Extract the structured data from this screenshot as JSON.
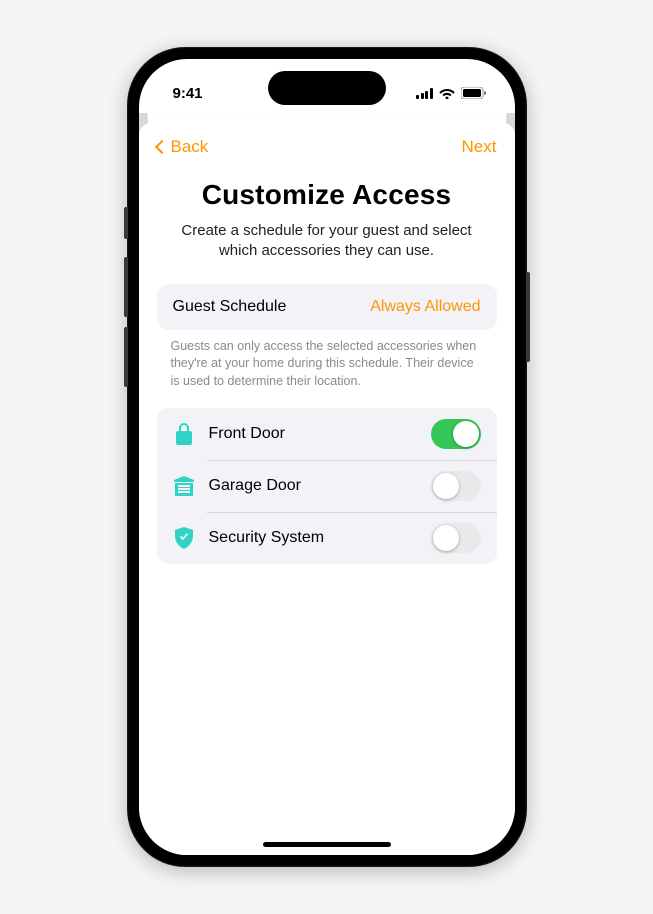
{
  "statusbar": {
    "time": "9:41"
  },
  "nav": {
    "back_label": "Back",
    "next_label": "Next"
  },
  "header": {
    "title": "Customize Access",
    "subtitle": "Create a schedule for your guest and select which accessories they can use."
  },
  "schedule": {
    "label": "Guest Schedule",
    "value": "Always Allowed",
    "footnote": "Guests can only access the selected accessories when they're at your home during this schedule. Their device is used to determine their location."
  },
  "accessories": [
    {
      "icon": "lock",
      "label": "Front Door",
      "enabled": true
    },
    {
      "icon": "garage",
      "label": "Garage Door",
      "enabled": false
    },
    {
      "icon": "shield",
      "label": "Security System",
      "enabled": false
    }
  ],
  "colors": {
    "accent": "#ff9500",
    "switch_on": "#34c759",
    "icon": "#30d5c8"
  }
}
